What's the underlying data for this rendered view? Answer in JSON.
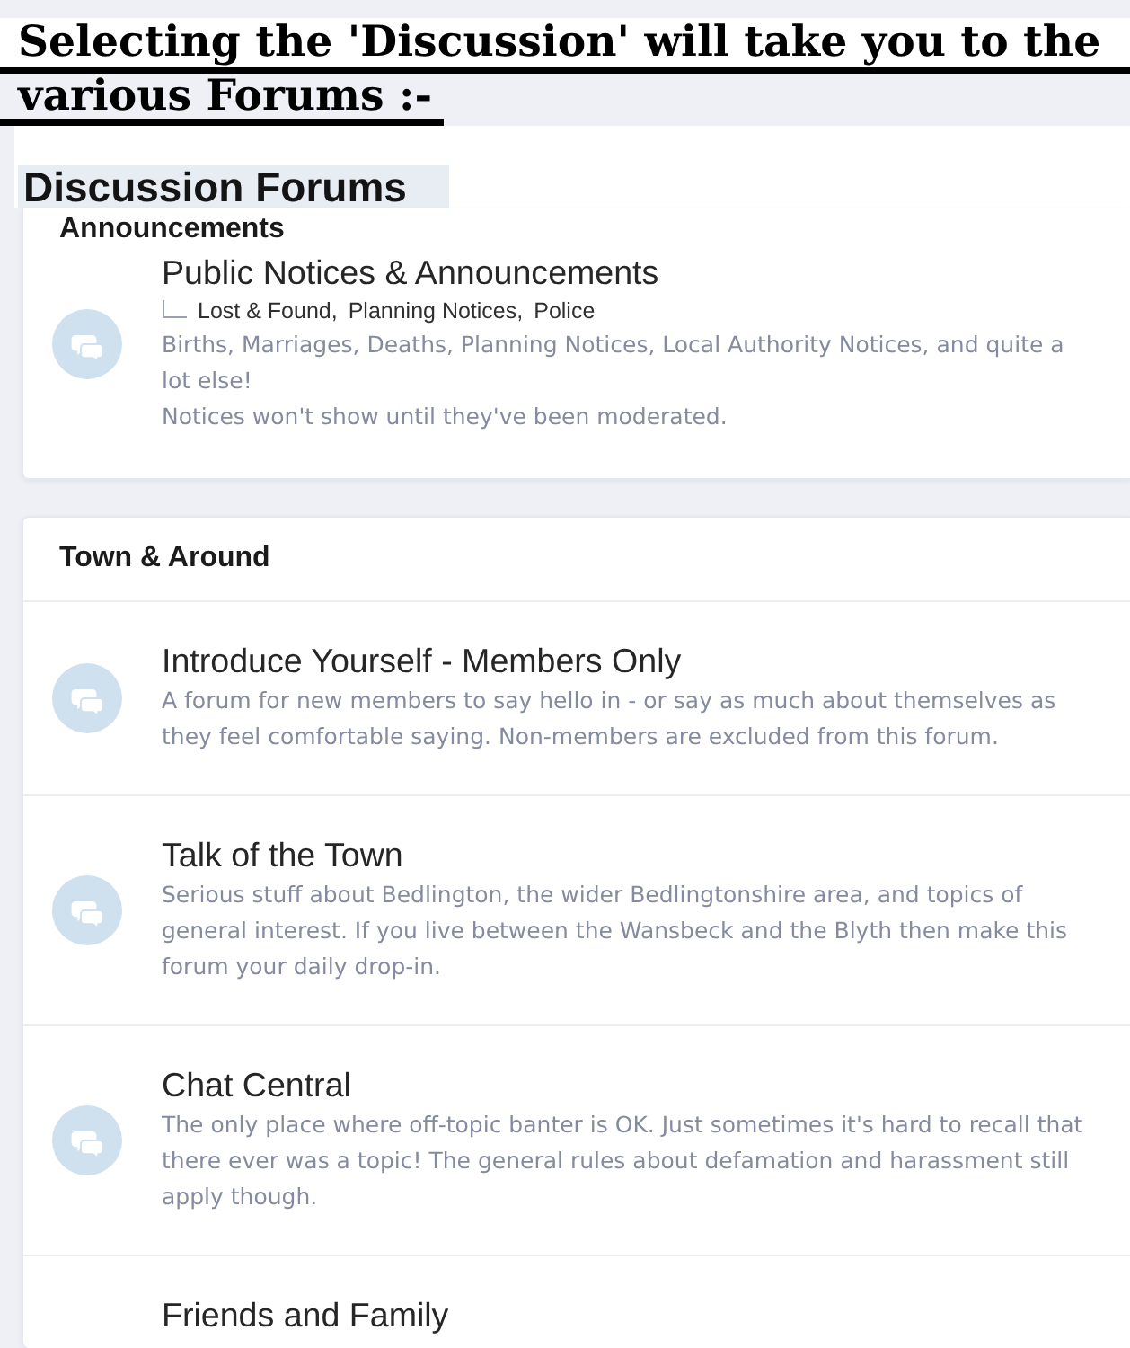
{
  "caption": {
    "lines": [
      "Selecting the 'Discussion' will take you to the",
      "various Forums :-"
    ]
  },
  "page": {
    "title": "Discussion Forums"
  },
  "categories": [
    {
      "title": "Announcements",
      "forums": [
        {
          "title": "Public Notices & Announcements",
          "subforums": [
            "Lost & Found,",
            "Planning Notices,",
            "Police"
          ],
          "description": [
            "Births, Marriages, Deaths, Planning Notices, Local Authority Notices, and quite a lot else!",
            "Notices won't show until they've been moderated."
          ]
        }
      ]
    },
    {
      "title": "Town & Around",
      "forums": [
        {
          "title": "Introduce Yourself - Members Only",
          "description": [
            "A forum for new members to say hello in - or say as much about themselves as they feel comfortable saying. Non-members are excluded from this forum."
          ]
        },
        {
          "title": "Talk of the Town",
          "description": [
            "Serious stuff about Bedlington, the wider Bedlingtonshire area, and topics of general interest. If you live between the Wansbeck and the Blyth then make this forum your daily drop-in."
          ]
        },
        {
          "title": "Chat Central",
          "description": [
            "The only place where off-topic banter is OK. Just sometimes it's hard to recall that there ever was a topic! The general rules about defamation and harassment still apply though."
          ]
        },
        {
          "title": "Friends and Family"
        }
      ]
    }
  ]
}
